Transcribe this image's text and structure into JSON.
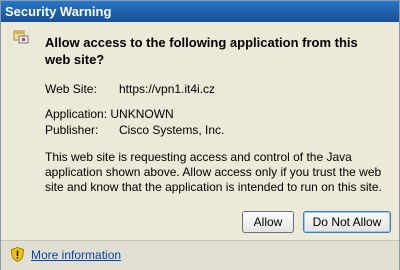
{
  "window": {
    "title": "Security Warning"
  },
  "dialog": {
    "heading": "Allow access to the following application from this web site?",
    "web_site_label": "Web Site:",
    "web_site_value": "https://vpn1.it4i.cz",
    "application_label": "Application:",
    "application_value": "UNKNOWN",
    "publisher_label": "Publisher:",
    "publisher_value": "Cisco Systems, Inc.",
    "description": "This web site is requesting access and control of the Java application shown above. Allow access only if you trust the web site and know that the application is intended to run on this site."
  },
  "buttons": {
    "allow": "Allow",
    "deny": "Do Not Allow"
  },
  "footer": {
    "more_info": "More information"
  },
  "icons": {
    "app": "java-app-icon",
    "footer": "shield-warning-icon"
  },
  "colors": {
    "titlebar": "#1e5fa8",
    "link": "#0645ad",
    "background": "#ece9d8"
  }
}
